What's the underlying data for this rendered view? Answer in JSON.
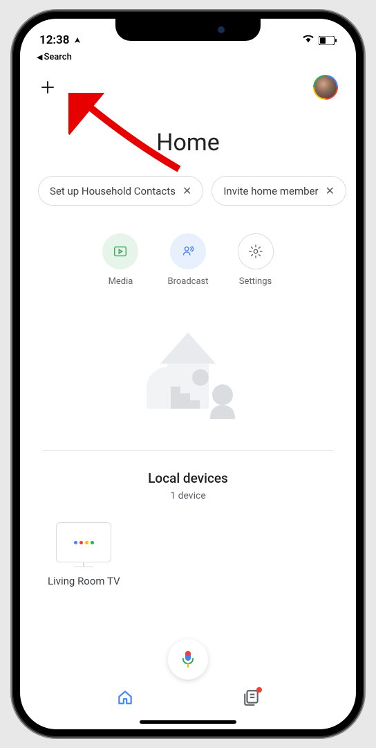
{
  "status": {
    "time": "12:38",
    "back_label": "Search"
  },
  "header": {
    "title": "Home"
  },
  "chips": [
    {
      "label": "Set up Household Contacts"
    },
    {
      "label": "Invite home member"
    }
  ],
  "quick_actions": {
    "media": "Media",
    "broadcast": "Broadcast",
    "settings": "Settings"
  },
  "local_devices": {
    "title": "Local devices",
    "count": "1 device",
    "items": [
      {
        "name": "Living Room TV"
      }
    ]
  },
  "colors": {
    "google_blue": "#4285f4",
    "google_red": "#ea4335",
    "google_yellow": "#fbbc04",
    "google_green": "#34a853"
  }
}
